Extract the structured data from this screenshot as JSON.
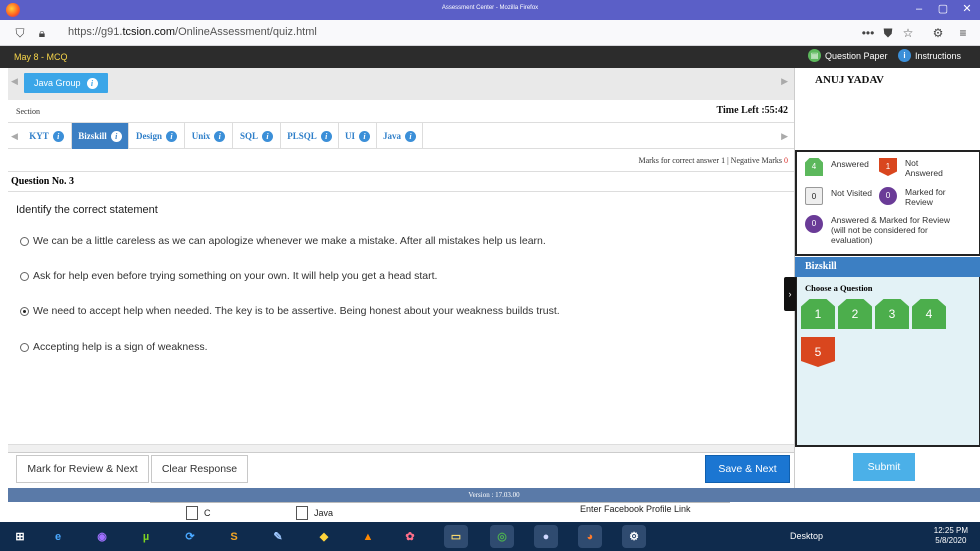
{
  "browser": {
    "window_title": "Assessment Center - Mozilla Firefox",
    "url_prefix": "https://g91.",
    "url_domain": "tcsion.com",
    "url_path": "/OnlineAssessment/quiz.html"
  },
  "exam_header": {
    "section_title": "May 8 - MCQ",
    "question_paper_label": "Question Paper",
    "instructions_label": "Instructions"
  },
  "group": {
    "label": "Java Group"
  },
  "section_label": "Section",
  "time_left": "Time Left :55:42",
  "tabs": [
    {
      "label": "KYT"
    },
    {
      "label": "Bizskill"
    },
    {
      "label": "Design"
    },
    {
      "label": "Unix"
    },
    {
      "label": "SQL"
    },
    {
      "label": "PLSQL"
    },
    {
      "label": "UI"
    },
    {
      "label": "Java"
    }
  ],
  "active_tab": "Bizskill",
  "marks": {
    "text": "Marks for correct answer 1 | Negative Marks ",
    "negative": "0"
  },
  "question": {
    "number_label": "Question No. 3",
    "text": "Identify the correct statement",
    "options": [
      "We can be a little careless as we can apologize whenever we make a mistake. After all mistakes help us learn.",
      "Ask for help even before trying something on your own. It will help you get a head start.",
      "We need to accept help when needed. The key is to be assertive. Being honest about your weakness builds trust.",
      "Accepting help is a sign of weakness."
    ],
    "selected_index": 2
  },
  "buttons": {
    "mark_review": "Mark for Review & Next",
    "clear": "Clear Response",
    "save_next": "Save & Next",
    "submit": "Submit"
  },
  "candidate": {
    "name": "ANUJ YADAV"
  },
  "legend": {
    "answered": {
      "count": "4",
      "label": "Answered"
    },
    "not_answered": {
      "count": "1",
      "label": "Not Answered"
    },
    "not_visited": {
      "count": "0",
      "label": "Not Visited"
    },
    "marked_review": {
      "count": "0",
      "label": "Marked for Review"
    },
    "answered_marked": {
      "count": "0",
      "label": "Answered & Marked for Review (will not be considered for evaluation)"
    }
  },
  "palette": {
    "section": "Bizskill",
    "choose_label": "Choose a Question",
    "questions": [
      {
        "n": "1",
        "state": "answered"
      },
      {
        "n": "2",
        "state": "answered"
      },
      {
        "n": "3",
        "state": "answered"
      },
      {
        "n": "4",
        "state": "answered"
      },
      {
        "n": "5",
        "state": "not_answered"
      }
    ]
  },
  "version": "Version : 17.03.00",
  "files": [
    {
      "name": "C"
    },
    {
      "name": "Java"
    },
    {
      "name": "Enter Facebook Profile Link"
    }
  ],
  "taskbar": {
    "desktop_label": "Desktop",
    "time": "12:25 PM",
    "date": "5/8/2020"
  },
  "colors": {
    "accent_blue": "#3c7fc3",
    "answered_green": "#5cb85c",
    "not_answered_red": "#d9461e",
    "review_purple": "#6a3b97",
    "save_blue": "#1b76d2",
    "submit_blue": "#4bb0e8"
  }
}
